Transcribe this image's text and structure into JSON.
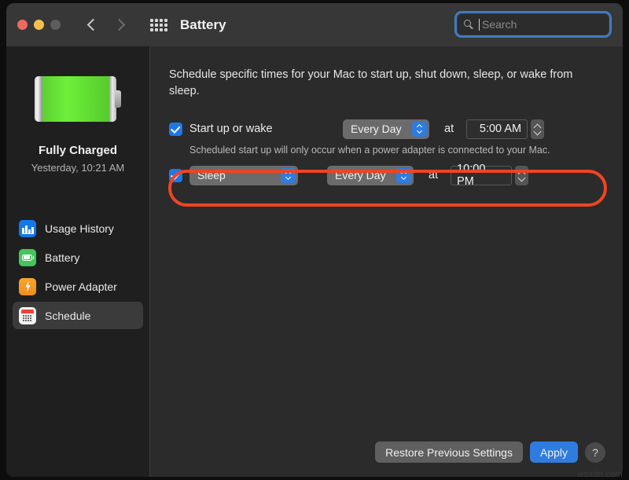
{
  "window": {
    "title": "Battery",
    "traffic_lights": [
      "close-button",
      "minimize-button",
      "zoom-button"
    ],
    "back_label": "Back",
    "forward_label": "Forward",
    "grid_label": "Show All"
  },
  "search": {
    "placeholder": "Search",
    "value": ""
  },
  "sidebar": {
    "battery_status": "Fully Charged",
    "battery_substatus": "Yesterday, 10:21 AM",
    "items": [
      {
        "label": "Usage History",
        "icon": "usage-history-icon",
        "selected": false
      },
      {
        "label": "Battery",
        "icon": "battery-icon",
        "selected": false
      },
      {
        "label": "Power Adapter",
        "icon": "power-adapter-icon",
        "selected": false
      },
      {
        "label": "Schedule",
        "icon": "schedule-icon",
        "selected": true
      }
    ]
  },
  "main": {
    "description": "Schedule specific times for your Mac to start up, shut down, sleep, or wake from sleep.",
    "startup_row": {
      "checked": true,
      "label": "Start up or wake",
      "day": "Every Day",
      "at": "at",
      "time": "5:00 AM"
    },
    "startup_hint": "Scheduled start up will only occur when a power adapter is connected to your Mac.",
    "sleep_row": {
      "checked": true,
      "action": "Sleep",
      "day": "Every Day",
      "at": "at",
      "time": "10:00 PM"
    },
    "annotation_color": "#f04423"
  },
  "footer": {
    "restore_label": "Restore Previous Settings",
    "apply_label": "Apply",
    "help_label": "?"
  },
  "watermark": "wsxdn.com"
}
